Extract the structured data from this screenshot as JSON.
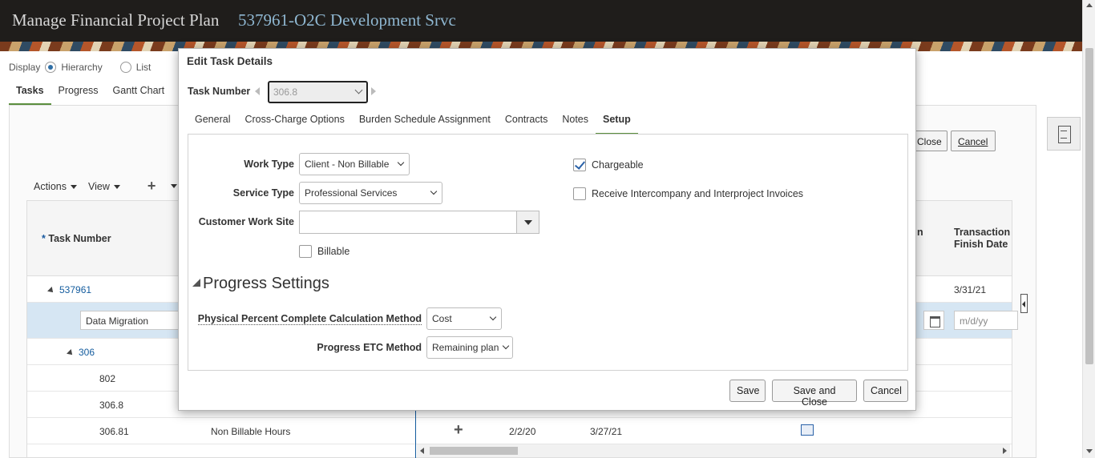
{
  "header": {
    "title": "Manage Financial Project Plan",
    "subtitle": "537961-O2C Development Srvc"
  },
  "display": {
    "label": "Display",
    "options": [
      {
        "label": "Hierarchy",
        "selected": true
      },
      {
        "label": "List",
        "selected": false
      }
    ]
  },
  "page_tabs": [
    {
      "label": "Tasks",
      "active": true
    },
    {
      "label": "Progress",
      "active": false
    },
    {
      "label": "Gantt Chart",
      "active": false
    }
  ],
  "toolbar": {
    "actions": "Actions",
    "view": "View",
    "add_icon": "plus-icon"
  },
  "background_buttons": {
    "close_fragment": "Close",
    "cancel": "Cancel"
  },
  "grid": {
    "col_task_number_req": "*",
    "col_task_number": "Task Number",
    "col_n_fragment": "n",
    "col_transaction_finish_1": "Transaction",
    "col_transaction_finish_2": "Finish Date",
    "rows": [
      {
        "task": "537961",
        "expanded": true,
        "finish": "3/31/21"
      },
      {
        "name_input": "Data Migration",
        "date_placeholder": "m/d/yy"
      },
      {
        "task": "306",
        "expanded": true
      },
      {
        "task": "802"
      },
      {
        "task": "306.8"
      },
      {
        "task": "306.81",
        "name": "Non Billable Hours",
        "start": "2/2/20",
        "finish": "3/27/21"
      }
    ]
  },
  "dialog": {
    "title": "Edit Task Details",
    "task_number_label": "Task Number",
    "task_number_value": "306.8",
    "tabs": [
      {
        "label": "General",
        "active": false
      },
      {
        "label": "Cross-Charge Options",
        "active": false
      },
      {
        "label": "Burden Schedule Assignment",
        "active": false
      },
      {
        "label": "Contracts",
        "active": false
      },
      {
        "label": "Notes",
        "active": false
      },
      {
        "label": "Setup",
        "active": true
      }
    ],
    "setup": {
      "work_type_label": "Work Type",
      "work_type_value": "Client - Non Billable",
      "service_type_label": "Service Type",
      "service_type_value": "Professional Services",
      "customer_work_site_label": "Customer Work Site",
      "customer_work_site_value": "",
      "billable_label": "Billable",
      "billable_checked": false,
      "chargeable_label": "Chargeable",
      "chargeable_checked": true,
      "intercompany_label": "Receive Intercompany and Interproject Invoices",
      "intercompany_checked": false,
      "progress_section_title": "Progress Settings",
      "physical_percent_label": "Physical Percent Complete Calculation Method",
      "physical_percent_value": "Cost",
      "progress_etc_label": "Progress ETC Method",
      "progress_etc_value": "Remaining plan"
    },
    "buttons": {
      "save": "Save",
      "save_and_close": "Save and Close",
      "cancel": "Cancel"
    }
  },
  "colors": {
    "banner_bg": "#1f1d1b",
    "accent_tab": "#5b8e3e",
    "link": "#145c9e",
    "selected_row": "#d6e6f3"
  }
}
